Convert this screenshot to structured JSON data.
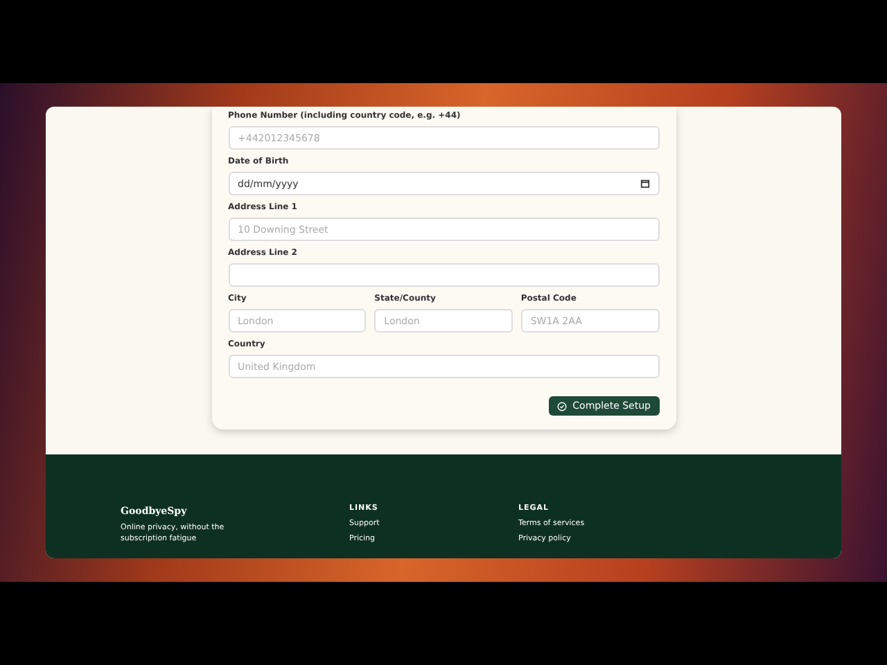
{
  "form": {
    "fields": [
      {
        "kind": "text",
        "label": "Phone Number (including country code, e.g. +44)",
        "placeholder": "+442012345678"
      },
      {
        "kind": "date",
        "label": "Date of Birth",
        "value": "dd/mm/yyyy"
      },
      {
        "kind": "text",
        "label": "Address Line 1",
        "placeholder": "10 Downing Street"
      },
      {
        "kind": "text",
        "label": "Address Line 2"
      }
    ],
    "row": [
      {
        "label": "City",
        "placeholder": "London"
      },
      {
        "label": "State/County",
        "placeholder": "London"
      },
      {
        "label": "Postal Code",
        "placeholder": "SW1A 2AA"
      }
    ],
    "country": {
      "label": "Country",
      "placeholder": "United Kingdom"
    },
    "submit": "Complete Setup"
  },
  "footer": {
    "brand": "GoodbyeSpy",
    "tagline": "Online privacy, without the subscription fatigue",
    "columns": [
      {
        "heading": "LINKS",
        "links": [
          "Support",
          "Pricing"
        ]
      },
      {
        "heading": "LEGAL",
        "links": [
          "Terms of services",
          "Privacy policy"
        ]
      }
    ]
  }
}
